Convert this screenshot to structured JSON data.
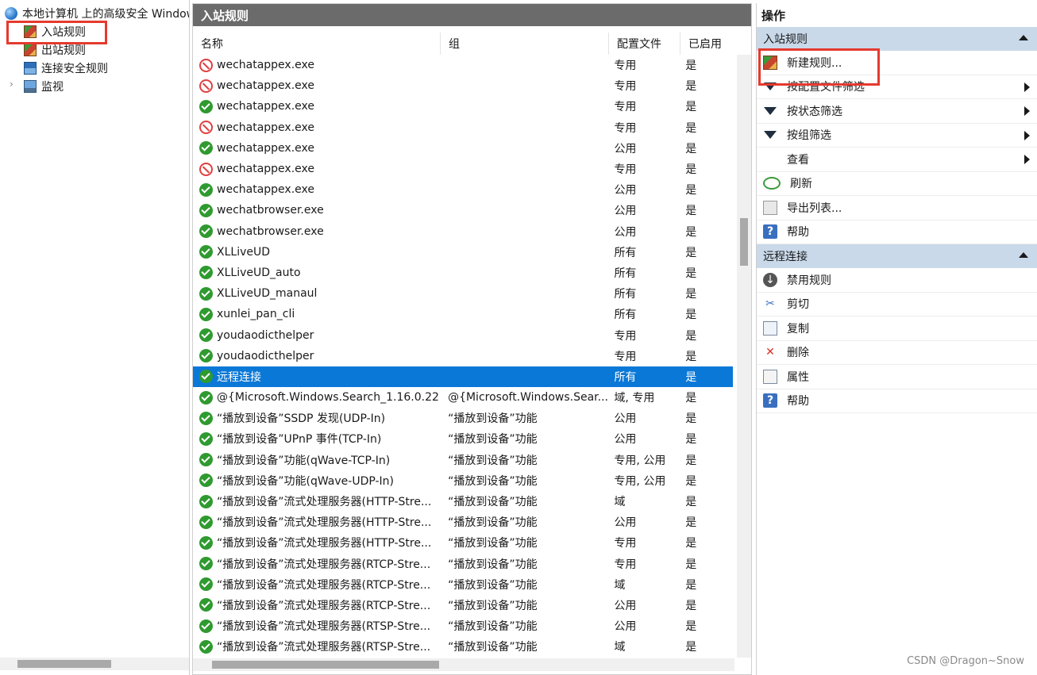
{
  "tree": {
    "root_label": "本地计算机 上的高级安全 Windows",
    "items": [
      {
        "label": "入站规则"
      },
      {
        "label": "出站规则"
      },
      {
        "label": "连接安全规则"
      },
      {
        "label": "监视"
      }
    ],
    "expander": "›"
  },
  "middle": {
    "title": "入站规则",
    "columns": [
      "名称",
      "组",
      "配置文件",
      "已启用"
    ],
    "rows": [
      {
        "status": "block",
        "name": "wechatappex.exe",
        "group": "",
        "profile": "专用",
        "enabled": "是"
      },
      {
        "status": "block",
        "name": "wechatappex.exe",
        "group": "",
        "profile": "专用",
        "enabled": "是"
      },
      {
        "status": "allow",
        "name": "wechatappex.exe",
        "group": "",
        "profile": "专用",
        "enabled": "是"
      },
      {
        "status": "block",
        "name": "wechatappex.exe",
        "group": "",
        "profile": "专用",
        "enabled": "是"
      },
      {
        "status": "allow",
        "name": "wechatappex.exe",
        "group": "",
        "profile": "公用",
        "enabled": "是"
      },
      {
        "status": "block",
        "name": "wechatappex.exe",
        "group": "",
        "profile": "专用",
        "enabled": "是"
      },
      {
        "status": "allow",
        "name": "wechatappex.exe",
        "group": "",
        "profile": "公用",
        "enabled": "是"
      },
      {
        "status": "allow",
        "name": "wechatbrowser.exe",
        "group": "",
        "profile": "公用",
        "enabled": "是"
      },
      {
        "status": "allow",
        "name": "wechatbrowser.exe",
        "group": "",
        "profile": "公用",
        "enabled": "是"
      },
      {
        "status": "allow",
        "name": "XLLiveUD",
        "group": "",
        "profile": "所有",
        "enabled": "是"
      },
      {
        "status": "allow",
        "name": "XLLiveUD_auto",
        "group": "",
        "profile": "所有",
        "enabled": "是"
      },
      {
        "status": "allow",
        "name": "XLLiveUD_manaul",
        "group": "",
        "profile": "所有",
        "enabled": "是"
      },
      {
        "status": "allow",
        "name": "xunlei_pan_cli",
        "group": "",
        "profile": "所有",
        "enabled": "是"
      },
      {
        "status": "allow",
        "name": "youdaodicthelper",
        "group": "",
        "profile": "专用",
        "enabled": "是"
      },
      {
        "status": "allow",
        "name": "youdaodicthelper",
        "group": "",
        "profile": "专用",
        "enabled": "是"
      },
      {
        "status": "allow",
        "name": "远程连接",
        "group": "",
        "profile": "所有",
        "enabled": "是",
        "selected": true
      },
      {
        "status": "allow",
        "name": "@{Microsoft.Windows.Search_1.16.0.22...",
        "group": "@{Microsoft.Windows.Sear...",
        "profile": "域, 专用",
        "enabled": "是"
      },
      {
        "status": "allow",
        "name": "“播放到设备”SSDP 发现(UDP-In)",
        "group": "“播放到设备”功能",
        "profile": "公用",
        "enabled": "是"
      },
      {
        "status": "allow",
        "name": "“播放到设备”UPnP 事件(TCP-In)",
        "group": "“播放到设备”功能",
        "profile": "公用",
        "enabled": "是"
      },
      {
        "status": "allow",
        "name": "“播放到设备”功能(qWave-TCP-In)",
        "group": "“播放到设备”功能",
        "profile": "专用, 公用",
        "enabled": "是"
      },
      {
        "status": "allow",
        "name": "“播放到设备”功能(qWave-UDP-In)",
        "group": "“播放到设备”功能",
        "profile": "专用, 公用",
        "enabled": "是"
      },
      {
        "status": "allow",
        "name": "“播放到设备”流式处理服务器(HTTP-Stre...",
        "group": "“播放到设备”功能",
        "profile": "域",
        "enabled": "是"
      },
      {
        "status": "allow",
        "name": "“播放到设备”流式处理服务器(HTTP-Stre...",
        "group": "“播放到设备”功能",
        "profile": "公用",
        "enabled": "是"
      },
      {
        "status": "allow",
        "name": "“播放到设备”流式处理服务器(HTTP-Stre...",
        "group": "“播放到设备”功能",
        "profile": "专用",
        "enabled": "是"
      },
      {
        "status": "allow",
        "name": "“播放到设备”流式处理服务器(RTCP-Stre...",
        "group": "“播放到设备”功能",
        "profile": "专用",
        "enabled": "是"
      },
      {
        "status": "allow",
        "name": "“播放到设备”流式处理服务器(RTCP-Stre...",
        "group": "“播放到设备”功能",
        "profile": "域",
        "enabled": "是"
      },
      {
        "status": "allow",
        "name": "“播放到设备”流式处理服务器(RTCP-Stre...",
        "group": "“播放到设备”功能",
        "profile": "公用",
        "enabled": "是"
      },
      {
        "status": "allow",
        "name": "“播放到设备”流式处理服务器(RTSP-Stre...",
        "group": "“播放到设备”功能",
        "profile": "公用",
        "enabled": "是"
      },
      {
        "status": "allow",
        "name": "“播放到设备”流式处理服务器(RTSP-Stre...",
        "group": "“播放到设备”功能",
        "profile": "域",
        "enabled": "是"
      }
    ]
  },
  "actions": {
    "title": "操作",
    "section1": {
      "label": "入站规则",
      "items": [
        {
          "label": "新建规则...",
          "icon": "new-rule-icon",
          "submenu": false
        },
        {
          "label": "按配置文件筛选",
          "icon": "filter-icon",
          "submenu": true
        },
        {
          "label": "按状态筛选",
          "icon": "filter-icon",
          "submenu": true
        },
        {
          "label": "按组筛选",
          "icon": "filter-icon",
          "submenu": true
        },
        {
          "label": "查看",
          "icon": "",
          "submenu": true
        },
        {
          "label": "刷新",
          "icon": "refresh-icon",
          "submenu": false
        },
        {
          "label": "导出列表...",
          "icon": "export-icon",
          "submenu": false
        },
        {
          "label": "帮助",
          "icon": "help-icon",
          "submenu": false
        }
      ]
    },
    "section2": {
      "label": "远程连接",
      "items": [
        {
          "label": "禁用规则",
          "icon": "disable-icon"
        },
        {
          "label": "剪切",
          "icon": "cut-icon"
        },
        {
          "label": "复制",
          "icon": "copy-icon"
        },
        {
          "label": "删除",
          "icon": "delete-icon"
        },
        {
          "label": "属性",
          "icon": "properties-icon"
        },
        {
          "label": "帮助",
          "icon": "help-icon"
        }
      ]
    }
  },
  "watermark": "CSDN @Dragon~Snow",
  "colors": {
    "selection": "#0a78d7",
    "highlight_box": "#e53a2f",
    "section_header": "#c9d9ea",
    "pane_header": "#6b6b6b"
  }
}
